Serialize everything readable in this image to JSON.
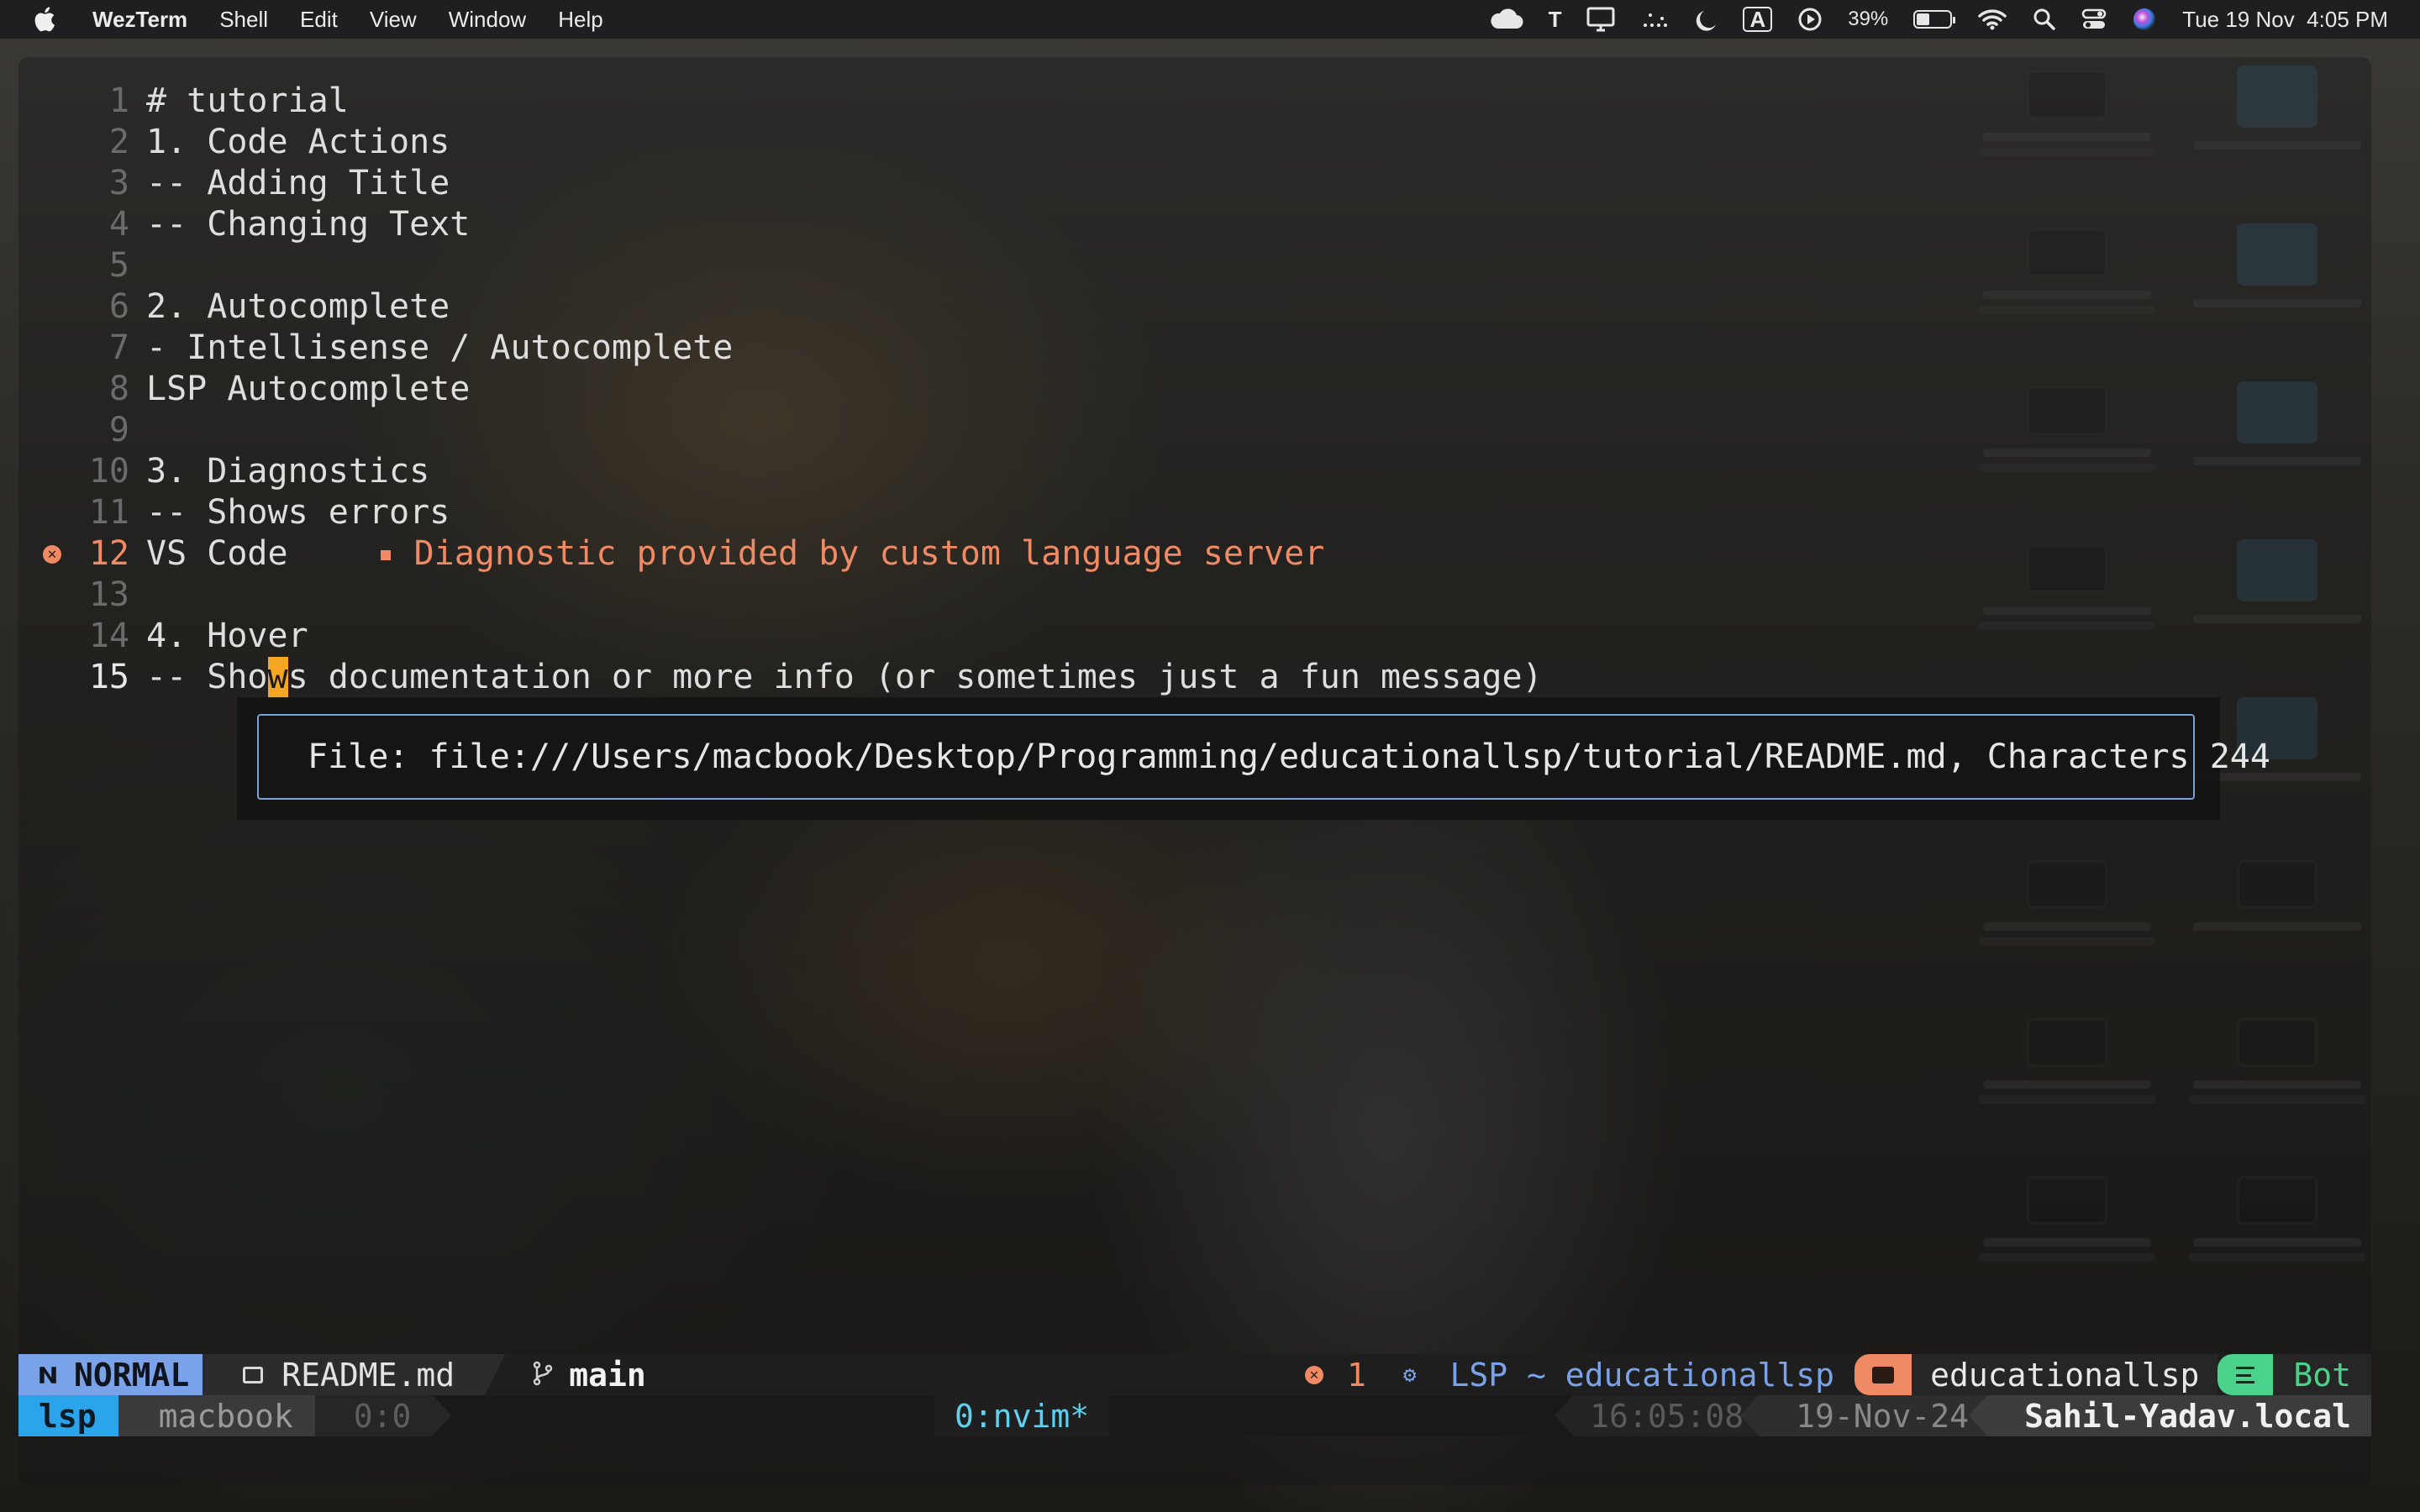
{
  "menubar": {
    "app_name": "WezTerm",
    "menus": [
      "Shell",
      "Edit",
      "View",
      "Window",
      "Help"
    ],
    "battery_percent": "39%",
    "battery_level": 0.39,
    "datetime": "Tue 19 Nov  4:05 PM",
    "text_input_letter": "T",
    "keyboard_indicator": "A",
    "status_icons": [
      "icloud-icon",
      "text-input-icon",
      "display-icon",
      "mirroring-icon",
      "focus-moon-icon",
      "keyboard-a-icon",
      "play-icon",
      "battery-icon",
      "wifi-icon",
      "spotlight-icon",
      "control-center-icon",
      "siri-icon"
    ]
  },
  "editor": {
    "lines": [
      {
        "num": "1",
        "text": "# tutorial"
      },
      {
        "num": "2",
        "text": "1. Code Actions"
      },
      {
        "num": "3",
        "text": "-- Adding Title"
      },
      {
        "num": "4",
        "text": "-- Changing Text"
      },
      {
        "num": "5",
        "text": ""
      },
      {
        "num": "6",
        "text": "2. Autocomplete"
      },
      {
        "num": "7",
        "text": "- Intellisense / Autocomplete"
      },
      {
        "num": "8",
        "text": "LSP Autocomplete"
      },
      {
        "num": "9",
        "text": ""
      },
      {
        "num": "10",
        "text": "3. Diagnostics"
      },
      {
        "num": "11",
        "text": "-- Shows errors"
      },
      {
        "num": "12",
        "text": "VS Code"
      },
      {
        "num": "13",
        "text": ""
      },
      {
        "num": "14",
        "text": "4. Hover"
      },
      {
        "num": "15",
        "text_before": "-- Sho",
        "cursor_char": "w",
        "text_after": "s documentation or more info (or sometimes just a fun message)"
      }
    ],
    "diagnostic_sign": "✕",
    "diagnostic_message": "Diagnostic provided by custom language server",
    "hover_text": "File: file:///Users/macbook/Desktop/Programming/educationallsp/tutorial/README.md, Characters 244"
  },
  "statusline": {
    "mode": "NORMAL",
    "filename": "README.md",
    "branch": "main",
    "error_count": "1",
    "lsp": "LSP ~ educationallsp",
    "cwd": "educationallsp",
    "position": "Bot"
  },
  "tmux": {
    "session": "lsp",
    "user": "macbook",
    "pane": "0:0",
    "window": "0:nvim*",
    "time": "16:05:08",
    "date": "19-Nov-24",
    "host": "Sahil-Yadav.local"
  },
  "colors": {
    "diagnostic": "#f08a64",
    "mode_bg": "#7aa2e8",
    "tmux_session_bg": "#2aa4ea",
    "position_accent": "#4ad28b",
    "cursor": "#f5a623",
    "hover_border": "#7aa2d8"
  }
}
